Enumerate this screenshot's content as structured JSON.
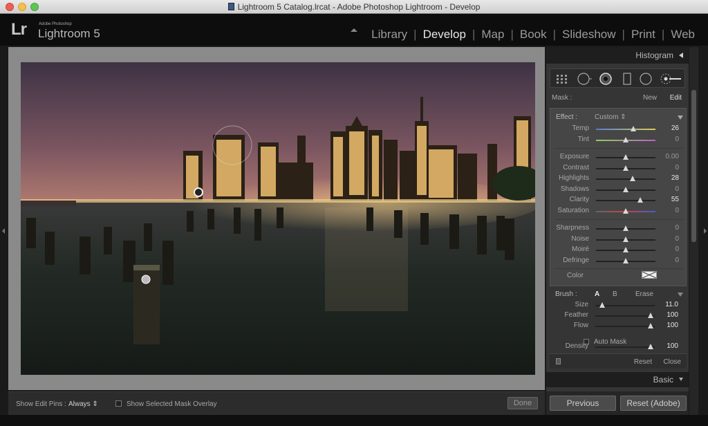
{
  "window": {
    "title": "Lightroom 5 Catalog.lrcat - Adobe Photoshop Lightroom - Develop"
  },
  "app": {
    "logo_mark": "Lr",
    "logo_small": "Adobe Photoshop",
    "logo_name": "Lightroom 5"
  },
  "modules": [
    {
      "label": "Library",
      "active": false
    },
    {
      "label": "Develop",
      "active": true
    },
    {
      "label": "Map",
      "active": false
    },
    {
      "label": "Book",
      "active": false
    },
    {
      "label": "Slideshow",
      "active": false
    },
    {
      "label": "Print",
      "active": false
    },
    {
      "label": "Web",
      "active": false
    }
  ],
  "panel": {
    "histogram_label": "Histogram",
    "mask": {
      "label": "Mask :",
      "new": "New",
      "edit": "Edit"
    },
    "effect": {
      "label": "Effect :",
      "value": "Custom"
    },
    "sliders": [
      {
        "label": "Temp",
        "value": "26",
        "pos": 0.63,
        "group": 1,
        "highlight": true
      },
      {
        "label": "Tint",
        "value": "0",
        "pos": 0.5,
        "group": 1,
        "highlight": false
      },
      {
        "label": "Exposure",
        "value": "0.00",
        "pos": 0.5,
        "group": 2,
        "highlight": false
      },
      {
        "label": "Contrast",
        "value": "0",
        "pos": 0.5,
        "group": 2,
        "highlight": false
      },
      {
        "label": "Highlights",
        "value": "28",
        "pos": 0.62,
        "group": 2,
        "highlight": true
      },
      {
        "label": "Shadows",
        "value": "0",
        "pos": 0.5,
        "group": 2,
        "highlight": false
      },
      {
        "label": "Clarity",
        "value": "55",
        "pos": 0.74,
        "group": 2,
        "highlight": true
      },
      {
        "label": "Saturation",
        "value": "0",
        "pos": 0.5,
        "group": 2,
        "highlight": false
      },
      {
        "label": "Sharpness",
        "value": "0",
        "pos": 0.5,
        "group": 3,
        "highlight": false
      },
      {
        "label": "Noise",
        "value": "0",
        "pos": 0.5,
        "group": 3,
        "highlight": false
      },
      {
        "label": "Moiré",
        "value": "0",
        "pos": 0.5,
        "group": 3,
        "highlight": false
      },
      {
        "label": "Defringe",
        "value": "0",
        "pos": 0.5,
        "group": 3,
        "highlight": false
      }
    ],
    "color_label": "Color",
    "brush": {
      "label": "Brush :",
      "a": "A",
      "b": "B",
      "erase": "Erase",
      "sliders": [
        {
          "label": "Size",
          "value": "11.0",
          "pos": 0.13
        },
        {
          "label": "Feather",
          "value": "100",
          "pos": 1.0
        },
        {
          "label": "Flow",
          "value": "100",
          "pos": 1.0
        },
        {
          "label": "Density",
          "value": "100",
          "pos": 1.0
        }
      ],
      "auto_mask": "Auto Mask"
    },
    "reset": "Reset",
    "close": "Close",
    "basic_label": "Basic",
    "previous_button": "Previous",
    "reset_button": "Reset (Adobe)"
  },
  "toolbar": {
    "show_edit_pins_label": "Show Edit Pins :",
    "show_edit_pins_value": "Always",
    "overlay_label": "Show Selected Mask Overlay",
    "done": "Done"
  },
  "colors": {
    "temp_track": "#5a7bd8",
    "tint_track": "#8fd060",
    "sky_top": "#4a3a4a",
    "sky_horizon": "#a06a6a",
    "water": "#1f2722"
  }
}
